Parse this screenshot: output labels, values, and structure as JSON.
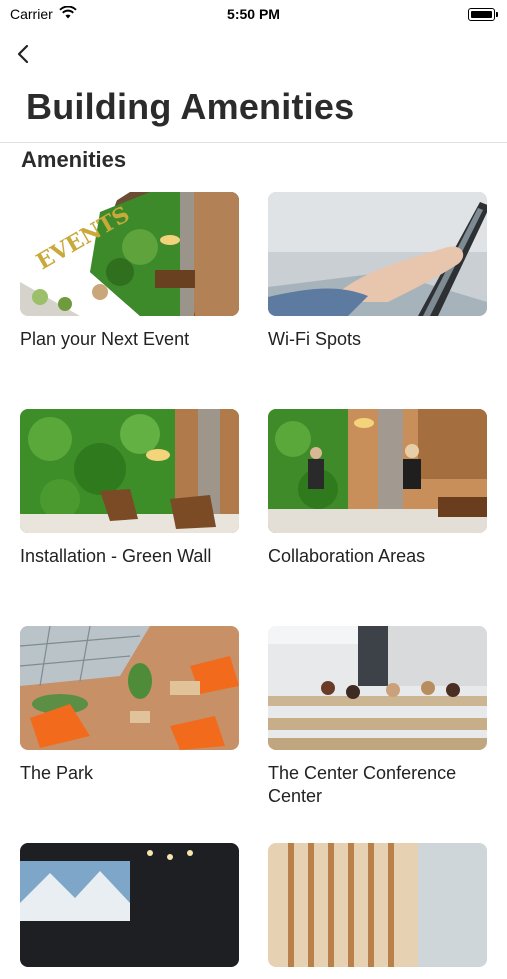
{
  "status_bar": {
    "carrier": "Carrier",
    "time": "5:50 PM"
  },
  "header": {
    "title": "Building Amenities"
  },
  "section": {
    "title": "Amenities"
  },
  "cards": [
    {
      "label": "Plan your Next Event",
      "thumb_text": "EVENTS"
    },
    {
      "label": "Wi-Fi Spots"
    },
    {
      "label": "Installation - Green Wall"
    },
    {
      "label": "Collaboration Areas"
    },
    {
      "label": "The Park"
    },
    {
      "label": "The Center Conference Center"
    },
    {
      "label": ""
    },
    {
      "label": ""
    }
  ],
  "colors": {
    "title": "#2b2b2b",
    "green_wall": "#3f8f2a",
    "wood": "#b07a4a",
    "orange_umbrella": "#f26b1d"
  }
}
